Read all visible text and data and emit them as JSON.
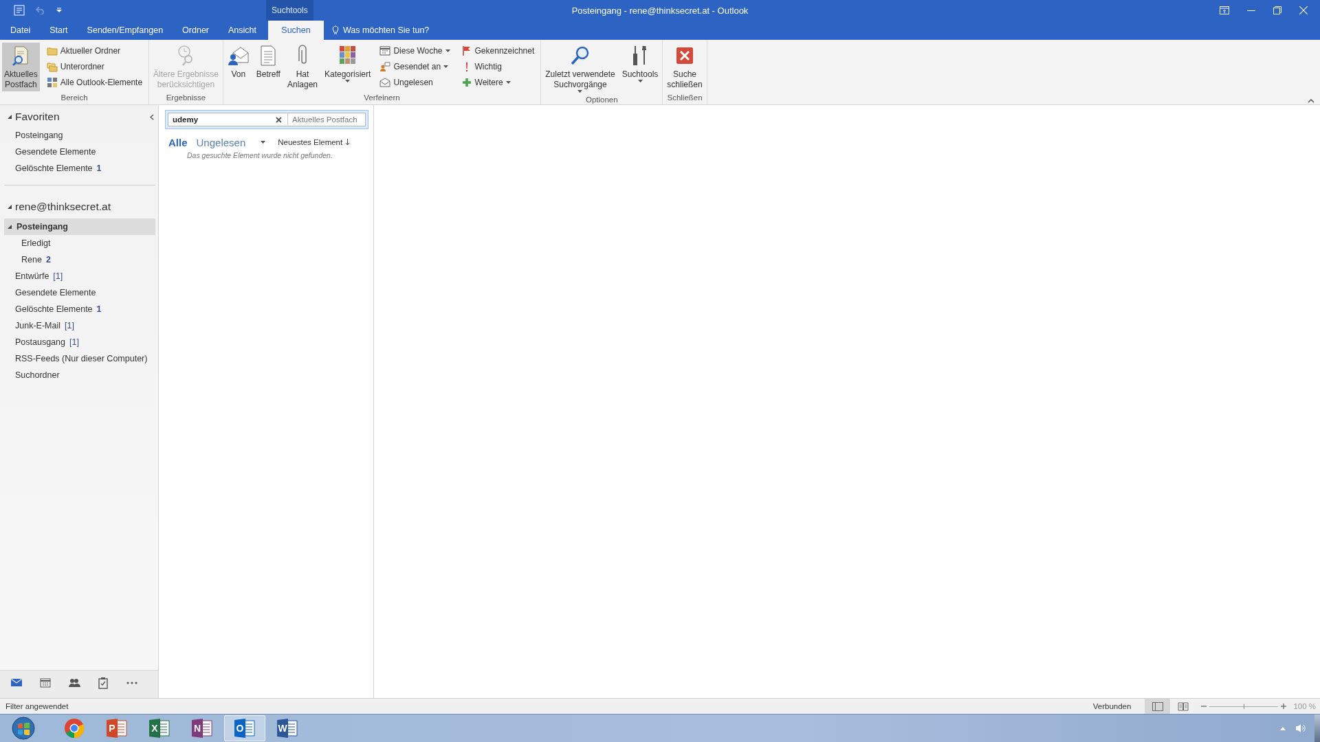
{
  "window": {
    "title": "Posteingang - rene@thinksecret.at - Outlook",
    "context_tab": "Suchtools"
  },
  "tabs": [
    {
      "label": "Datei",
      "selected": false
    },
    {
      "label": "Start",
      "selected": false
    },
    {
      "label": "Senden/Empfangen",
      "selected": false
    },
    {
      "label": "Ordner",
      "selected": false
    },
    {
      "label": "Ansicht",
      "selected": false
    },
    {
      "label": "Suchen",
      "selected": true
    }
  ],
  "tell_me": "Was möchten Sie tun?",
  "ribbon": [
    {
      "label": "Bereich",
      "controls": [
        {
          "kind": "large",
          "label": "Aktuelles\nPostfach",
          "selected": true,
          "disabled": false,
          "dropdown": false
        },
        {
          "kind": "small",
          "label": "Aktueller Ordner",
          "selected": false,
          "disabled": false,
          "dropdown": false
        },
        {
          "kind": "small",
          "label": "Unterordner",
          "selected": false,
          "disabled": false,
          "dropdown": false
        },
        {
          "kind": "small",
          "label": "Alle Outlook-Elemente",
          "selected": false,
          "disabled": false,
          "dropdown": false
        }
      ]
    },
    {
      "label": "Ergebnisse",
      "controls": [
        {
          "kind": "large",
          "label": "Ältere Ergebnisse\nberücksichtigen",
          "disabled": true,
          "dropdown": false
        }
      ]
    },
    {
      "label": "Verfeinern",
      "controls": [
        {
          "kind": "large",
          "label": "Von",
          "disabled": false,
          "dropdown": false
        },
        {
          "kind": "large",
          "label": "Betreff",
          "disabled": false,
          "dropdown": false
        },
        {
          "kind": "large",
          "label": "Hat\nAnlagen",
          "disabled": false,
          "dropdown": false
        },
        {
          "kind": "large",
          "label": "Kategorisiert",
          "disabled": false,
          "dropdown": true
        },
        {
          "kind": "small",
          "label": "Diese Woche",
          "disabled": false,
          "dropdown": true
        },
        {
          "kind": "small",
          "label": "Gesendet an",
          "disabled": false,
          "dropdown": true
        },
        {
          "kind": "small",
          "label": "Ungelesen",
          "disabled": false,
          "dropdown": false
        },
        {
          "kind": "small",
          "label": "Gekennzeichnet",
          "disabled": false,
          "dropdown": false
        },
        {
          "kind": "small",
          "label": "Wichtig",
          "disabled": false,
          "dropdown": false
        },
        {
          "kind": "small",
          "label": "Weitere",
          "disabled": false,
          "dropdown": true
        }
      ]
    },
    {
      "label": "Optionen",
      "controls": [
        {
          "kind": "large",
          "label": "Zuletzt verwendete\nSuchvorgänge",
          "disabled": false,
          "dropdown": true
        },
        {
          "kind": "large",
          "label": "Suchtools",
          "disabled": false,
          "dropdown": true
        }
      ]
    },
    {
      "label": "Schließen",
      "controls": [
        {
          "kind": "large",
          "label": "Suche\nschließen",
          "disabled": false,
          "dropdown": false
        }
      ]
    }
  ],
  "favorites": {
    "label": "Favoriten",
    "expanded": true,
    "items": [
      {
        "label": "Posteingang",
        "selected": false
      },
      {
        "label": "Gesendete Elemente",
        "selected": false
      },
      {
        "label": "Gelöschte Elemente",
        "count": "1",
        "count_bold": true,
        "selected": false
      }
    ]
  },
  "account": {
    "label": "rene@thinksecret.at",
    "expanded": true,
    "folders": [
      {
        "label": "Posteingang",
        "selected": true,
        "expanded": true,
        "children": [
          {
            "label": "Erledigt",
            "selected": false
          },
          {
            "label": "Rene",
            "count": "2",
            "count_bold": true,
            "selected": false
          }
        ]
      },
      {
        "label": "Entwürfe",
        "count": "[1]",
        "count_bold": false,
        "selected": false
      },
      {
        "label": "Gesendete Elemente",
        "selected": false
      },
      {
        "label": "Gelöschte Elemente",
        "count": "1",
        "count_bold": true,
        "selected": false
      },
      {
        "label": "Junk-E-Mail",
        "count": "[1]",
        "count_bold": false,
        "selected": false
      },
      {
        "label": "Postausgang",
        "count": "[1]",
        "count_bold": false,
        "selected": false
      },
      {
        "label": "RSS-Feeds (Nur dieser Computer)",
        "selected": false
      },
      {
        "label": "Suchordner",
        "selected": false
      }
    ]
  },
  "nav": [
    {
      "selected": true
    },
    {
      "selected": false
    },
    {
      "selected": false
    },
    {
      "selected": false
    },
    {
      "selected": false
    }
  ],
  "search": {
    "value": "udemy",
    "scope": "Aktuelles Postfach"
  },
  "filters": [
    {
      "label": "Alle",
      "selected": true
    },
    {
      "label": "Ungelesen",
      "selected": false
    }
  ],
  "sort": "Neuestes Element",
  "empty_message": "Das gesuchte Element wurde nicht gefunden.",
  "status_bar": {
    "left": "Filter angewendet",
    "connection": "Verbunden",
    "views": [
      {
        "selected": true
      },
      {
        "selected": false
      }
    ],
    "zoom": {
      "level": 0.5,
      "reading": "100 %"
    }
  },
  "taskbar": {
    "apps": [
      {
        "kind": "start",
        "selected": false
      },
      {
        "kind": "chrome",
        "selected": false
      },
      {
        "kind": "office",
        "letter": "P",
        "color": "#d24726",
        "selected": false
      },
      {
        "kind": "office",
        "letter": "X",
        "color": "#217346",
        "selected": false
      },
      {
        "kind": "office",
        "letter": "N",
        "color": "#80397b",
        "selected": false
      },
      {
        "kind": "office",
        "letter": "O",
        "color": "#0a64c8",
        "selected": true
      },
      {
        "kind": "office",
        "letter": "W",
        "color": "#2b579a",
        "selected": false
      }
    ]
  }
}
